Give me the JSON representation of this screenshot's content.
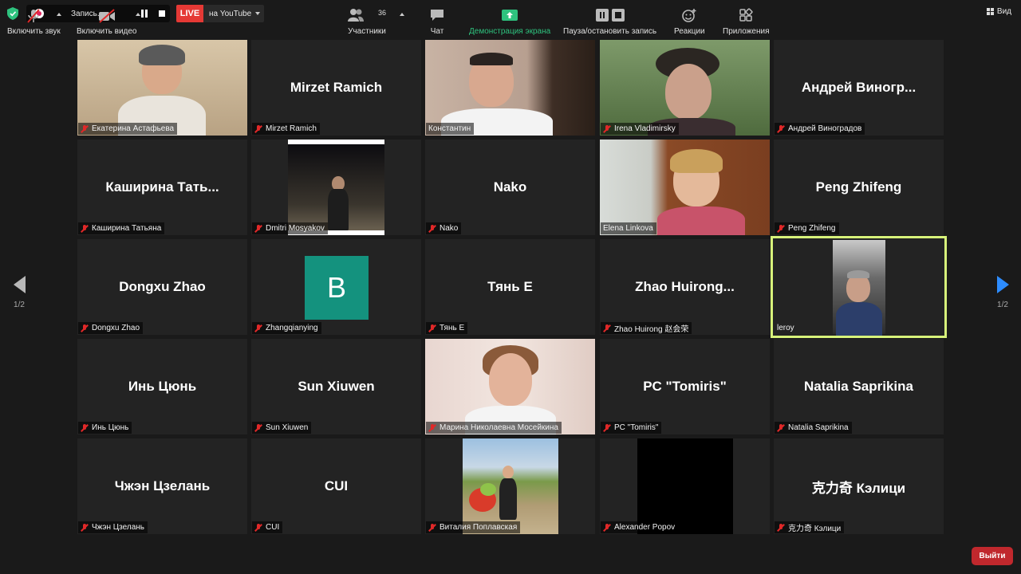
{
  "topbar": {
    "recording_label": "Запись...",
    "live_badge": "LIVE",
    "live_destination": "на YouTube",
    "view_label": "Вид"
  },
  "pager": {
    "left_page": "1/2",
    "right_page": "1/2"
  },
  "tiles": [
    {
      "center": "",
      "name": "Екатерина Астафьева"
    },
    {
      "center": "Mirzet Ramich",
      "name": "Mirzet Ramich"
    },
    {
      "center": "",
      "name": "Константин"
    },
    {
      "center": "",
      "name": "Irena Vladimirsky"
    },
    {
      "center": "Андрей Виногр...",
      "name": "Андрей Виноградов"
    },
    {
      "center": "Каширина Тать...",
      "name": "Каширина Татьяна"
    },
    {
      "center": "",
      "name": "Dmitri Mosyakov"
    },
    {
      "center": "Nako",
      "name": "Nako"
    },
    {
      "center": "",
      "name": "Elena Linkova"
    },
    {
      "center": "Peng Zhifeng",
      "name": "Peng Zhifeng"
    },
    {
      "center": "Dongxu Zhao",
      "name": "Dongxu Zhao"
    },
    {
      "center": "",
      "name": "Zhangqianying",
      "avatar": "B"
    },
    {
      "center": "Тянь Е",
      "name": "Тянь Е"
    },
    {
      "center": "Zhao Huirong...",
      "name": "Zhao Huirong 赵会荣"
    },
    {
      "center": "",
      "name": "leroy"
    },
    {
      "center": "Инь Цюнь",
      "name": "Инь Цюнь"
    },
    {
      "center": "Sun Xiuwen",
      "name": "Sun Xiuwen"
    },
    {
      "center": "",
      "name": "Марина Николаевна  Мосейкина"
    },
    {
      "center": "PC \"Tomiris\"",
      "name": "PC \"Tomiris\""
    },
    {
      "center": "Natalia Saprikina",
      "name": "Natalia Saprikina"
    },
    {
      "center": "Чжэн Цзелань",
      "name": "Чжэн Цзелань"
    },
    {
      "center": "CUI",
      "name": "CUI"
    },
    {
      "center": "",
      "name": "Виталия Поплавская"
    },
    {
      "center": "",
      "name": "Alexander Popov"
    },
    {
      "center": "克力奇 Кэлици",
      "name": "克力奇 Кэлици"
    }
  ],
  "toolbar": {
    "audio": "Включить звук",
    "video": "Включить видео",
    "participants": "Участники",
    "participants_count": "36",
    "chat": "Чат",
    "share": "Демонстрация экрана",
    "record": "Пауза/остановить запись",
    "reactions": "Реакции",
    "apps": "Приложения",
    "leave": "Выйти"
  },
  "colors": {
    "accent": "#2d8cff",
    "live": "#e53935",
    "leave": "#c0282d",
    "share": "#2ec27e",
    "active_speaker": "#d7f27a"
  }
}
